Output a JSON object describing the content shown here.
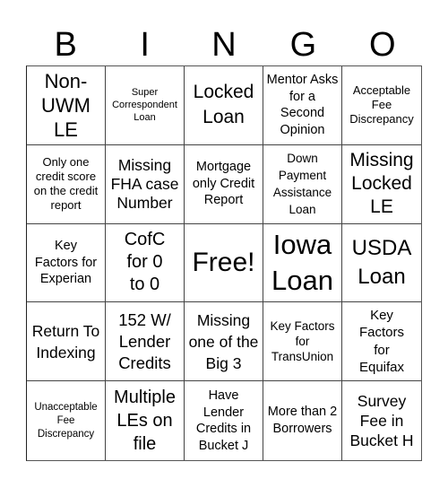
{
  "header": [
    "B",
    "I",
    "N",
    "G",
    "O"
  ],
  "cells": [
    "Non-\nUWM\nLE",
    "Super Correspondent Loan",
    "Locked Loan",
    "Mentor Asks for a Second Opinion",
    "Acceptable Fee Discrepancy",
    "Only one credit score on the credit report",
    "Missing FHA case Number",
    "Mortgage only Credit Report",
    "Down Payment Assistance Loan",
    "Missing Locked LE",
    "Key Factors for Experian",
    "CofC for 0 to 0",
    "Free!",
    "Iowa Loan",
    "USDA Loan",
    "Return To Indexing",
    "152 W/ Lender Credits",
    "Missing one of the Big 3",
    "Key Factors for TransUnion",
    "Key Factors for Equifax",
    "Unacceptable Fee Discrepancy",
    "Multiple LEs on file",
    "Have Lender Credits in Bucket J",
    "More than 2 Borrowers",
    "Survey Fee in Bucket H"
  ]
}
